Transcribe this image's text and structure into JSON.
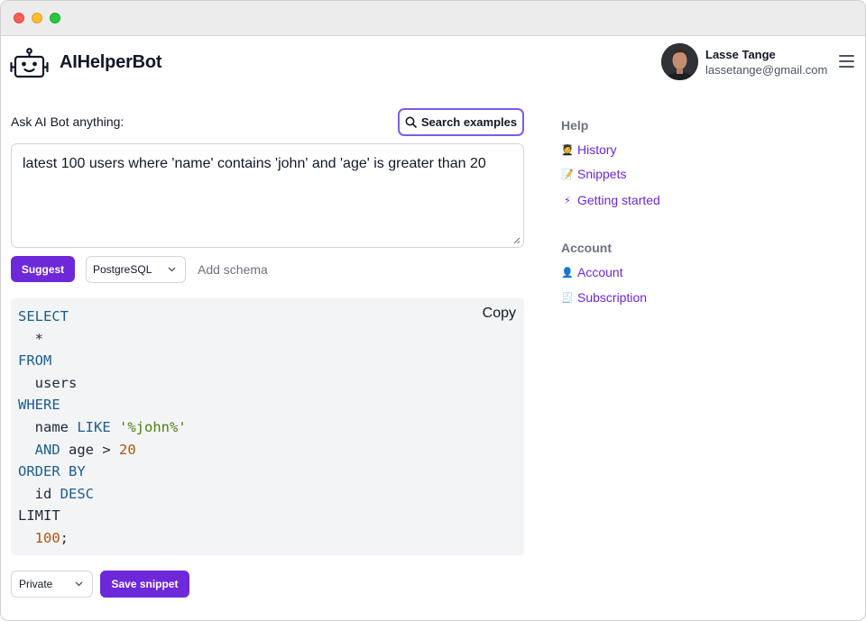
{
  "app": {
    "title": "AIHelperBot"
  },
  "user": {
    "name": "Lasse Tange",
    "email": "lassetange@gmail.com"
  },
  "ask": {
    "label": "Ask AI Bot anything:",
    "search_examples_label": "Search examples",
    "query": "latest 100 users where 'name' contains 'john' and 'age' is greater than 20"
  },
  "controls": {
    "suggest_label": "Suggest",
    "dialect": "PostgreSQL",
    "add_schema_label": "Add schema"
  },
  "result": {
    "copy_label": "Copy",
    "lines": [
      [
        {
          "t": "SELECT",
          "c": "kw"
        }
      ],
      [
        {
          "t": "  *",
          "c": "plain"
        }
      ],
      [
        {
          "t": "FROM",
          "c": "kw"
        }
      ],
      [
        {
          "t": "  users",
          "c": "plain"
        }
      ],
      [
        {
          "t": "WHERE",
          "c": "kw"
        }
      ],
      [
        {
          "t": "  name ",
          "c": "plain"
        },
        {
          "t": "LIKE",
          "c": "kw"
        },
        {
          "t": " ",
          "c": "plain"
        },
        {
          "t": "'%john%'",
          "c": "str"
        }
      ],
      [
        {
          "t": "  ",
          "c": "plain"
        },
        {
          "t": "AND",
          "c": "kw"
        },
        {
          "t": " age > ",
          "c": "plain"
        },
        {
          "t": "20",
          "c": "num"
        }
      ],
      [
        {
          "t": "ORDER BY",
          "c": "kw"
        }
      ],
      [
        {
          "t": "  id ",
          "c": "plain"
        },
        {
          "t": "DESC",
          "c": "kw"
        }
      ],
      [
        {
          "t": "LIMIT",
          "c": "plain"
        }
      ],
      [
        {
          "t": "  ",
          "c": "plain"
        },
        {
          "t": "100",
          "c": "num"
        },
        {
          "t": ";",
          "c": "plain"
        }
      ]
    ]
  },
  "footer": {
    "visibility": "Private",
    "save_label": "Save snippet"
  },
  "sidebar": {
    "help_heading": "Help",
    "help_items": [
      {
        "icon": "🧑‍🎓",
        "icon_name": "student-icon",
        "label": "History"
      },
      {
        "icon": "📝",
        "icon_name": "memo-icon",
        "label": "Snippets"
      },
      {
        "icon": "⚡",
        "icon_name": "lightning-icon",
        "label": "Getting started"
      }
    ],
    "account_heading": "Account",
    "account_items": [
      {
        "icon": "👤",
        "icon_name": "user-icon",
        "label": "Account"
      },
      {
        "icon": "🧾",
        "icon_name": "receipt-icon",
        "label": "Subscription"
      }
    ]
  },
  "colors": {
    "accent": "#6d28d9",
    "search_border": "#7c5ce7",
    "keyword": "#1d5d8f",
    "string": "#4d7f0c",
    "number": "#b45309"
  }
}
